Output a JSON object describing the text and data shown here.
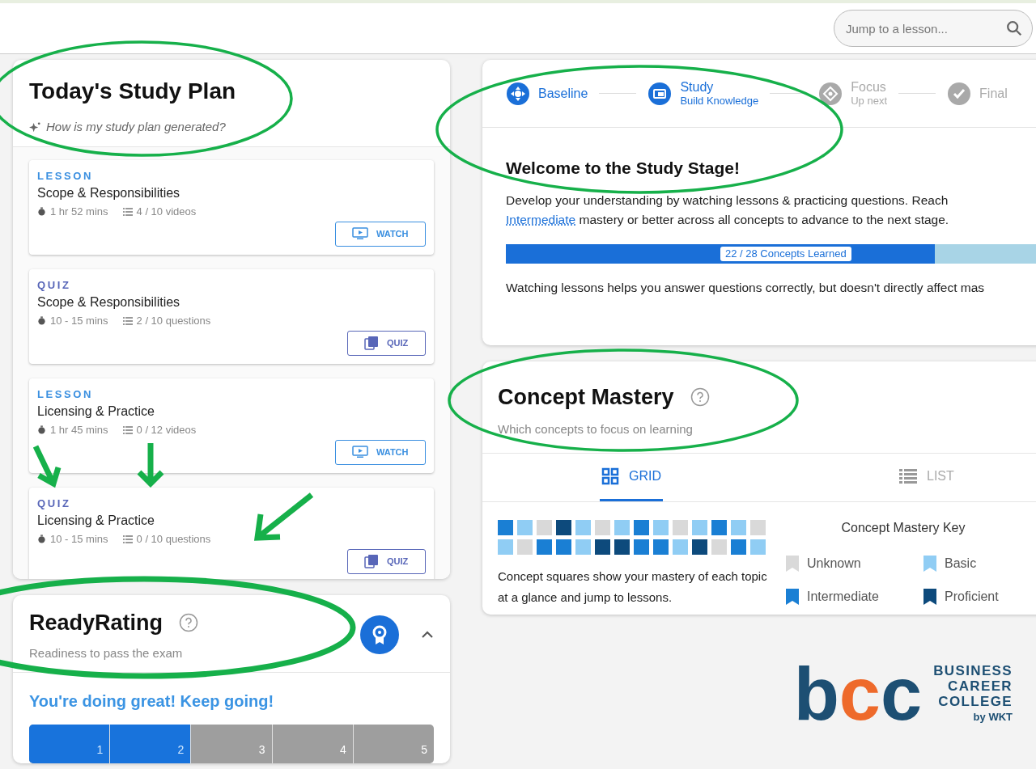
{
  "search": {
    "placeholder": "Jump to a lesson..."
  },
  "study_plan": {
    "title": "Today's Study Plan",
    "help_link": "How is my study plan generated?",
    "items": [
      {
        "kind": "lesson",
        "type_label": "LESSON",
        "title": "Scope & Responsibilities",
        "duration": "1 hr 52 mins",
        "progress": "4 / 10 videos",
        "action": "WATCH"
      },
      {
        "kind": "quiz",
        "type_label": "QUIZ",
        "title": "Scope & Responsibilities",
        "duration": "10 - 15 mins",
        "progress": "2 / 10 questions",
        "action": "QUIZ"
      },
      {
        "kind": "lesson",
        "type_label": "LESSON",
        "title": "Licensing & Practice",
        "duration": "1 hr 45 mins",
        "progress": "0 / 12 videos",
        "action": "WATCH"
      },
      {
        "kind": "quiz",
        "type_label": "QUIZ",
        "title": "Licensing & Practice",
        "duration": "10 - 15 mins",
        "progress": "0 / 10 questions",
        "action": "QUIZ"
      }
    ]
  },
  "ready_rating": {
    "title": "ReadyRating",
    "subtitle": "Readiness to pass the exam",
    "expanded": true,
    "message": "You're doing great! Keep going!",
    "level": 0.4,
    "segments": [
      "1",
      "2",
      "3",
      "4",
      "5"
    ]
  },
  "stages": [
    {
      "name": "Baseline",
      "kind": "done"
    },
    {
      "name": "Study",
      "caption": "Build Knowledge",
      "kind": "current"
    },
    {
      "name": "Focus",
      "caption": "Up next",
      "kind": "upcoming"
    },
    {
      "name": "Final",
      "kind": "final"
    }
  ],
  "stage_intro": {
    "title": "Welcome to the Study Stage!",
    "text_before": "Develop your understanding by watching lessons & practicing questions. Reach",
    "link": "Intermediate",
    "text_after": "mastery or better across all concepts to advance to the next stage.",
    "progress_label": "22 / 28 Concepts Learned",
    "level": 0.79,
    "note": "Watching lessons helps you answer questions correctly, but doesn't directly affect mas"
  },
  "concept_mastery": {
    "title": "Concept Mastery",
    "subtitle": "Which concepts to focus on learning",
    "tabs": [
      {
        "label": "GRID",
        "kind": "grid",
        "selected": true
      },
      {
        "label": "LIST",
        "kind": "list",
        "selected": false
      }
    ],
    "squares": [
      {
        "kind": "intermediate"
      },
      {
        "kind": "basic"
      },
      {
        "kind": "unknown"
      },
      {
        "kind": "proficient"
      },
      {
        "kind": "basic"
      },
      {
        "kind": "unknown"
      },
      {
        "kind": "basic"
      },
      {
        "kind": "intermediate"
      },
      {
        "kind": "basic"
      },
      {
        "kind": "unknown"
      },
      {
        "kind": "basic"
      },
      {
        "kind": "intermediate"
      },
      {
        "kind": "basic"
      },
      {
        "kind": "unknown"
      },
      {
        "kind": "basic"
      },
      {
        "kind": "unknown"
      },
      {
        "kind": "intermediate"
      },
      {
        "kind": "intermediate"
      },
      {
        "kind": "basic"
      },
      {
        "kind": "proficient"
      },
      {
        "kind": "proficient"
      },
      {
        "kind": "intermediate"
      },
      {
        "kind": "intermediate"
      },
      {
        "kind": "basic"
      },
      {
        "kind": "proficient"
      },
      {
        "kind": "unknown"
      },
      {
        "kind": "intermediate"
      },
      {
        "kind": "basic"
      }
    ],
    "description": "Concept squares show your mastery of each topic at a glance and jump to lessons.",
    "key_title": "Concept Mastery Key",
    "key": [
      {
        "label": "Unknown",
        "color": "#d9d9d9"
      },
      {
        "label": "Basic",
        "color": "#90cdf4"
      },
      {
        "label": "Intermediate",
        "color": "#1a7fd4"
      },
      {
        "label": "Proficient",
        "color": "#0d4a7c"
      }
    ]
  },
  "logo": {
    "letters": [
      {
        "char": "b",
        "color": "#1d4f73"
      },
      {
        "char": "c",
        "color": "#ee6a2b"
      },
      {
        "char": "c",
        "color": "#1d4f73"
      }
    ],
    "lines": [
      "BUSINESS",
      "CAREER",
      "COLLEGE"
    ],
    "byline": "by WKT"
  }
}
